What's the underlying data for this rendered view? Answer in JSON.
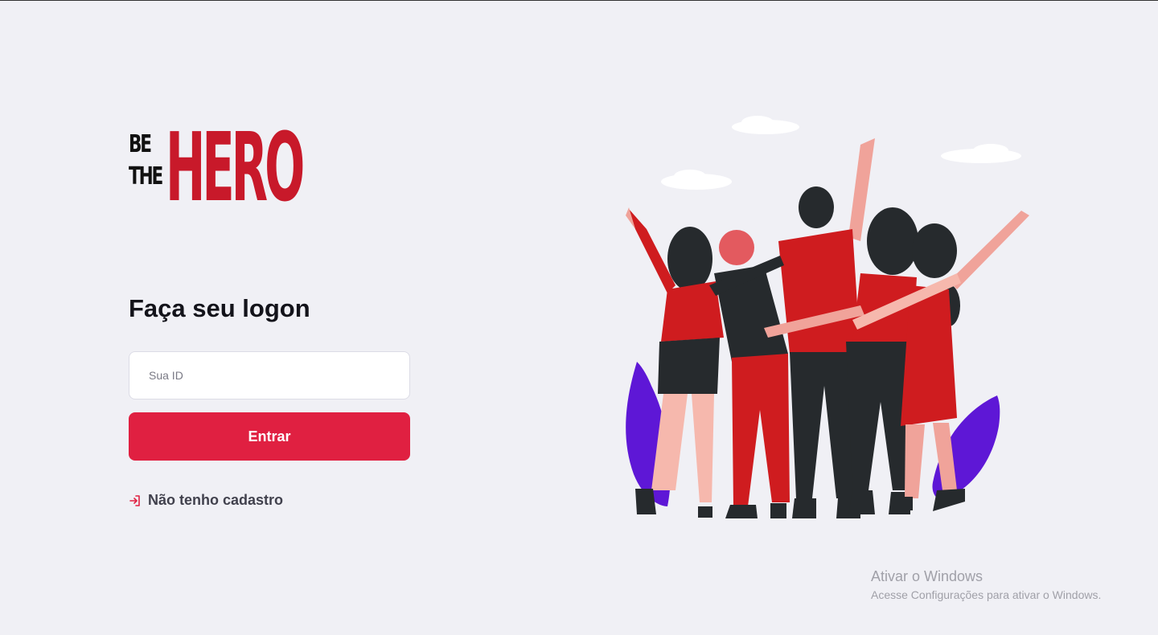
{
  "logo": {
    "be": "BE",
    "the": "THE",
    "hero": "HERO"
  },
  "form": {
    "title": "Faça seu logon",
    "id_placeholder": "Sua ID",
    "id_value": "",
    "submit_label": "Entrar",
    "register_link_label": "Não tenho cadastro",
    "register_icon": "log-in-icon"
  },
  "illustration": {
    "name": "heroes-group-illustration"
  },
  "watermark": {
    "title": "Ativar o Windows",
    "subtitle": "Acesse Configurações para ativar o Windows."
  },
  "colors": {
    "background": "#f0f0f5",
    "accent": "#e02041",
    "logo_red": "#c8192a",
    "text_dark": "#13131a",
    "text_link": "#41414d"
  }
}
